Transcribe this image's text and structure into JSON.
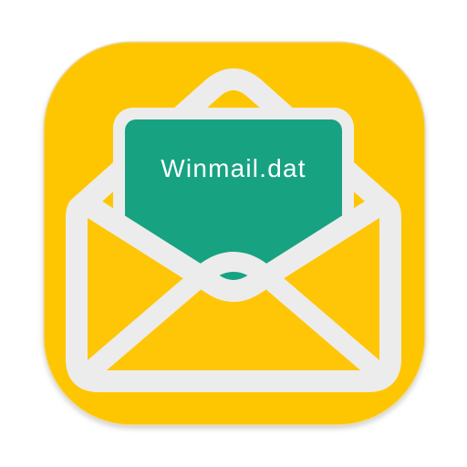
{
  "app_icon": {
    "name": "Winmail.dat",
    "icon": "open-envelope-icon",
    "colors": {
      "background": "#ffffff",
      "tile": "#fec606",
      "tile_border": "#ead8a0",
      "envelope_outline": "#ececec",
      "card": "#17a281",
      "label": "#ffffff"
    }
  }
}
